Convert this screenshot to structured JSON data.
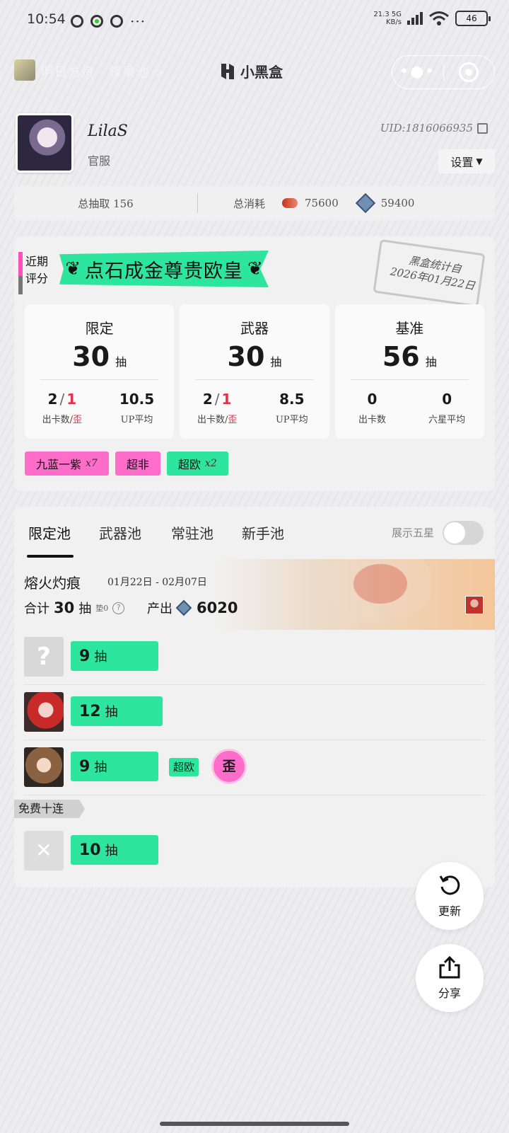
{
  "status_bar": {
    "time": "10:54",
    "more": "···",
    "net_speed_value": "21.3",
    "net_speed_unit": "KB/s",
    "network": "5G",
    "battery": "46"
  },
  "nav": {
    "game_title": "明日方舟 · 锋录池 >",
    "brand": "小黑盒",
    "more": "•●•"
  },
  "profile": {
    "name": "LilaS",
    "server": "官服",
    "uid": "UID:1816066935",
    "settings_label": "设置",
    "settings_arrow": "▼"
  },
  "totals": {
    "total_pulls": "总抽取 156",
    "consumption_label": "总消耗",
    "orundum": "75600",
    "originite": "59400"
  },
  "summary": {
    "recent_label_1": "近期",
    "recent_label_2": "评分",
    "rating": "点石成金尊贵欧皇",
    "laurel_left": "❦",
    "laurel_right": "❦",
    "stamp_line1": "黑盒统计自",
    "stamp_line2": "2026年01月22日",
    "pools": [
      {
        "title": "限定",
        "pulls": "30",
        "unit": "抽",
        "v1_a": "2",
        "v1_b": "1",
        "v2": "10.5",
        "label1_a": "出卡数",
        "label1_b": "歪",
        "label2": "UP平均"
      },
      {
        "title": "武器",
        "pulls": "30",
        "unit": "抽",
        "v1_a": "2",
        "v1_b": "1",
        "v2": "8.5",
        "label1_a": "出卡数",
        "label1_b": "歪",
        "label2": "UP平均"
      },
      {
        "title": "基准",
        "pulls": "56",
        "unit": "抽",
        "v1": "0",
        "v2": "0",
        "label1": "出卡数",
        "label2": "六星平均"
      }
    ],
    "tags": [
      {
        "text": "九蓝一紫",
        "count": "x7",
        "color": "pink"
      },
      {
        "text": "超非",
        "count": "",
        "color": "pink"
      },
      {
        "text": "超欧",
        "count": "x2",
        "color": "green"
      }
    ]
  },
  "pool_tabs": {
    "tabs": [
      "限定池",
      "武器池",
      "常驻池",
      "新手池"
    ],
    "active_index": 0,
    "toggle_label": "展示五星",
    "toggle_on": false
  },
  "banner": {
    "name": "熔火灼痕",
    "date": "01月22日 - 02月07日",
    "sum_label": "合计",
    "sum_pulls": "30",
    "sum_unit": "抽",
    "pity": "垫0",
    "help": "?",
    "output_label": "产出",
    "output_value": "6020"
  },
  "pulls": [
    {
      "count": "9",
      "unit": "抽",
      "avatar": "unknown"
    },
    {
      "count": "12",
      "unit": "抽",
      "avatar": "red-hair"
    },
    {
      "count": "9",
      "unit": "抽",
      "avatar": "brown-hair",
      "tag": "超欧",
      "badge": "歪"
    },
    {
      "count": "10",
      "unit": "抽",
      "avatar": "empty"
    }
  ],
  "free_label": "免费十连",
  "actions": {
    "refresh": "更新",
    "share": "分享"
  },
  "colors": {
    "accent_green": "#2ee59d",
    "accent_pink": "#ff6dcb",
    "alert_red": "#e0334b"
  }
}
